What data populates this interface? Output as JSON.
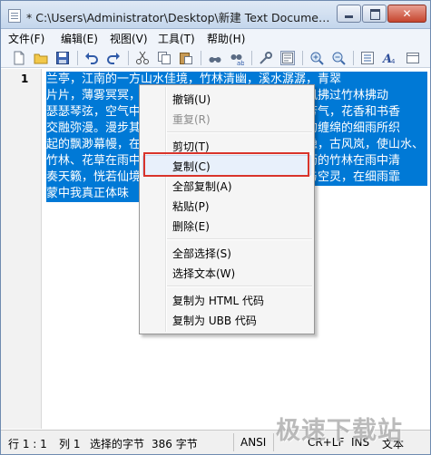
{
  "window": {
    "title": "* C:\\Users\\Administrator\\Desktop\\新建 Text Document.t..."
  },
  "menubar": {
    "items": [
      "文件(F)",
      "编辑(E)",
      "视图(V)",
      "工具(T)",
      "帮助(H)"
    ]
  },
  "toolbar": {
    "icons": [
      "new-file-icon",
      "open-folder-icon",
      "save-icon",
      "undo-icon",
      "redo-icon",
      "cut-icon",
      "copy-icon",
      "paste-icon",
      "find-icon",
      "replace-icon",
      "tools-icon",
      "view-toggle-icon",
      "zoom-in-icon",
      "zoom-out-icon",
      "list-icon",
      "font-icon",
      "view-mode-icon"
    ]
  },
  "editor": {
    "line_number": "1",
    "selected_lines": [
      "兰亭，江南的一方山水佳境，竹林清幽，溪水潺潺，青翠",
      "片片，薄雾冥冥，漫步于此，仿佛置身于画中，微风拂过竹林拂动",
      "瑟瑟琴弦，空气中弥漫着淡淡的清香，那是竹叶的芳气，花香和书香",
      "交融弥漫。漫步其间，仿佛穿越千年，那连绵不断的缠绵的细雨所织",
      "起的飘渺幕幔，在微风中轻轻摇曳，远处的青山隐隐，古风岚，使山水、",
      "竹林、花草在雨中更显灵动，令人心旷神怡，那淅沥的竹林在雨中清",
      "奏天籁，恍若仙境，超凡脱俗，带给人无限的遐想与空灵，在细雨霏",
      "蒙中我真正体味"
    ]
  },
  "context_menu": {
    "items": [
      {
        "label": "撤销(U)",
        "enabled": true
      },
      {
        "label": "重复(R)",
        "enabled": false
      },
      {
        "label": "剪切(T)",
        "enabled": true
      },
      {
        "label": "复制(C)",
        "enabled": true
      },
      {
        "label": "全部复制(A)",
        "enabled": true
      },
      {
        "label": "粘贴(P)",
        "enabled": true
      },
      {
        "label": "删除(E)",
        "enabled": true
      },
      {
        "label": "全部选择(S)",
        "enabled": true
      },
      {
        "label": "选择文本(W)",
        "enabled": true
      },
      {
        "label": "复制为 HTML 代码",
        "enabled": true
      },
      {
        "label": "复制为 UBB 代码",
        "enabled": true
      }
    ],
    "highlighted_item": "复制(C)",
    "highlight_color": "#d9342b"
  },
  "statusbar": {
    "position": "行 1 : 1",
    "column": "列 1",
    "selected_label": "选择的字节",
    "byte_count": "386 字节",
    "encoding": "ANSI",
    "line_ending": "CR+LF",
    "insert_mode": "INS",
    "doc_type": "文本"
  },
  "watermark": {
    "text": "极速下载站"
  },
  "colors": {
    "selection": "#0079d6",
    "titlebar": "#c4d6ec",
    "close_button": "#c6452e"
  }
}
